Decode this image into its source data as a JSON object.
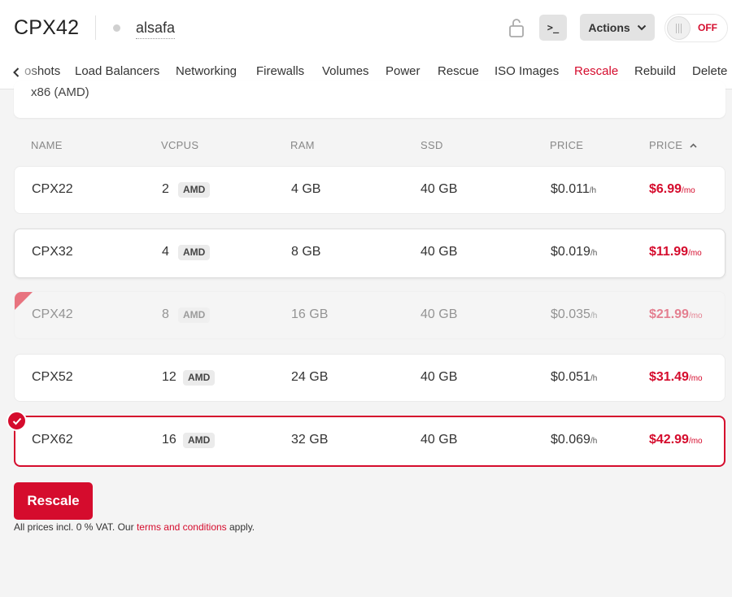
{
  "header": {
    "title": "CPX42",
    "server_name": "alsafa",
    "console_label": ">_",
    "actions_label": "Actions",
    "power_label": "OFF"
  },
  "tabs": [
    {
      "label": "Snapshots",
      "visible_text": "oshots"
    },
    {
      "label": "Load Balancers"
    },
    {
      "label": "Networking"
    },
    {
      "label": "Firewalls"
    },
    {
      "label": "Volumes"
    },
    {
      "label": "Power"
    },
    {
      "label": "Rescue"
    },
    {
      "label": "ISO Images"
    },
    {
      "label": "Rescale",
      "active": true
    },
    {
      "label": "Rebuild"
    },
    {
      "label": "Delete"
    }
  ],
  "architecture": {
    "label": "x86 (AMD)"
  },
  "table": {
    "columns": [
      "NAME",
      "VCPUS",
      "RAM",
      "SSD",
      "PRICE",
      "PRICE"
    ],
    "sort_column_index": 5,
    "sort_direction": "ascending",
    "rows": [
      {
        "name": "CPX22",
        "vcpus": "2",
        "cpu_badge": "AMD",
        "ram": "4 GB",
        "ssd": "40 GB",
        "price_hour": "$0.011",
        "hour_unit": "/h",
        "price_month": "$6.99",
        "month_unit": "/mo",
        "state": "normal"
      },
      {
        "name": "CPX32",
        "vcpus": "4",
        "cpu_badge": "AMD",
        "ram": "8 GB",
        "ssd": "40 GB",
        "price_hour": "$0.019",
        "hour_unit": "/h",
        "price_month": "$11.99",
        "month_unit": "/mo",
        "state": "focused"
      },
      {
        "name": "CPX42",
        "vcpus": "8",
        "cpu_badge": "AMD",
        "ram": "16 GB",
        "ssd": "40 GB",
        "price_hour": "$0.035",
        "hour_unit": "/h",
        "price_month": "$21.99",
        "month_unit": "/mo",
        "state": "current"
      },
      {
        "name": "CPX52",
        "vcpus": "12",
        "cpu_badge": "AMD",
        "ram": "24 GB",
        "ssd": "40 GB",
        "price_hour": "$0.051",
        "hour_unit": "/h",
        "price_month": "$31.49",
        "month_unit": "/mo",
        "state": "normal"
      },
      {
        "name": "CPX62",
        "vcpus": "16",
        "cpu_badge": "AMD",
        "ram": "32 GB",
        "ssd": "40 GB",
        "price_hour": "$0.069",
        "hour_unit": "/h",
        "price_month": "$42.99",
        "month_unit": "/mo",
        "state": "selected"
      }
    ]
  },
  "footer": {
    "rescale_label": "Rescale",
    "note_prefix": "All prices incl. 0 % VAT. Our ",
    "note_link": "terms and conditions",
    "note_suffix": " apply."
  },
  "colors": {
    "accent": "#d50c2d",
    "background": "#f4f4f4",
    "card": "#ffffff"
  },
  "icons": [
    "lock-icon",
    "console-icon",
    "chevron-down-icon",
    "chevron-left-icon",
    "sort-ascending-icon",
    "checkmark-icon",
    "toggle-grip-icon"
  ]
}
